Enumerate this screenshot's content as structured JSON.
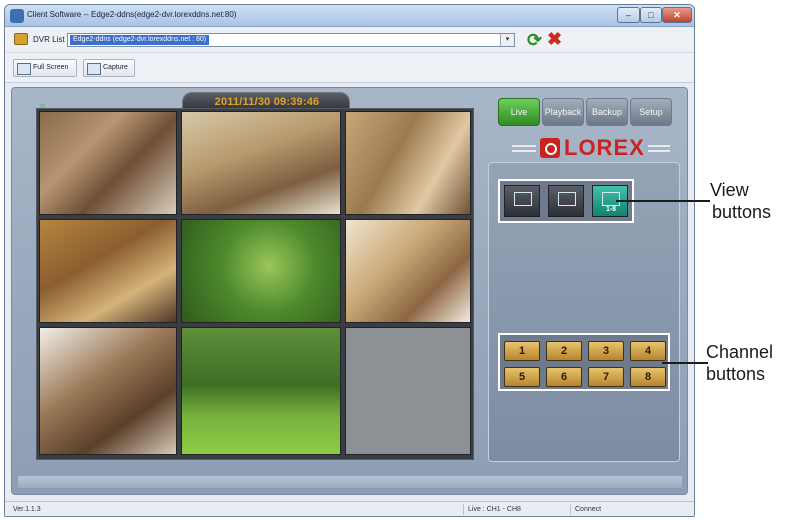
{
  "window": {
    "title": "Client Software -- Edge2-ddns(edge2-dvr.lorexddns.net:80)",
    "minimize_glyph": "–",
    "maximize_glyph": "□",
    "close_glyph": "✕"
  },
  "toolbar": {
    "dvr_list_label": "DVR List",
    "dvr_selected": "Edge2-ddns (edge2-dvr.lorexddns.net : 80)",
    "dropdown_glyph": "▾",
    "refresh_glyph": "⟳",
    "delete_glyph": "✖",
    "full_screen_label": "Full Screen",
    "capture_label": "Capture"
  },
  "viewer": {
    "channel_indicator": "0",
    "datetime": "2011/11/30 09:39:46"
  },
  "tabs": [
    "Live",
    "Playback",
    "Backup",
    "Setup"
  ],
  "brand": {
    "logo_text": "LOREX",
    "color": "#c9241f"
  },
  "view_buttons": [
    {
      "label": "",
      "active": false
    },
    {
      "label": "",
      "active": false
    },
    {
      "label": "1-8",
      "active": true
    }
  ],
  "channels": [
    "1",
    "2",
    "3",
    "4",
    "5",
    "6",
    "7",
    "8"
  ],
  "status": {
    "version": "Ver.1.1.3",
    "live_range": "Live : CH1 - CH8",
    "connection": "Connect"
  },
  "callouts": {
    "view": [
      "View",
      "buttons"
    ],
    "channel": [
      "Channel",
      "buttons"
    ]
  },
  "colors": {
    "active_tab": "#3fa830",
    "timestamp": "#e0a22c",
    "active_view": "#1ea28a"
  }
}
